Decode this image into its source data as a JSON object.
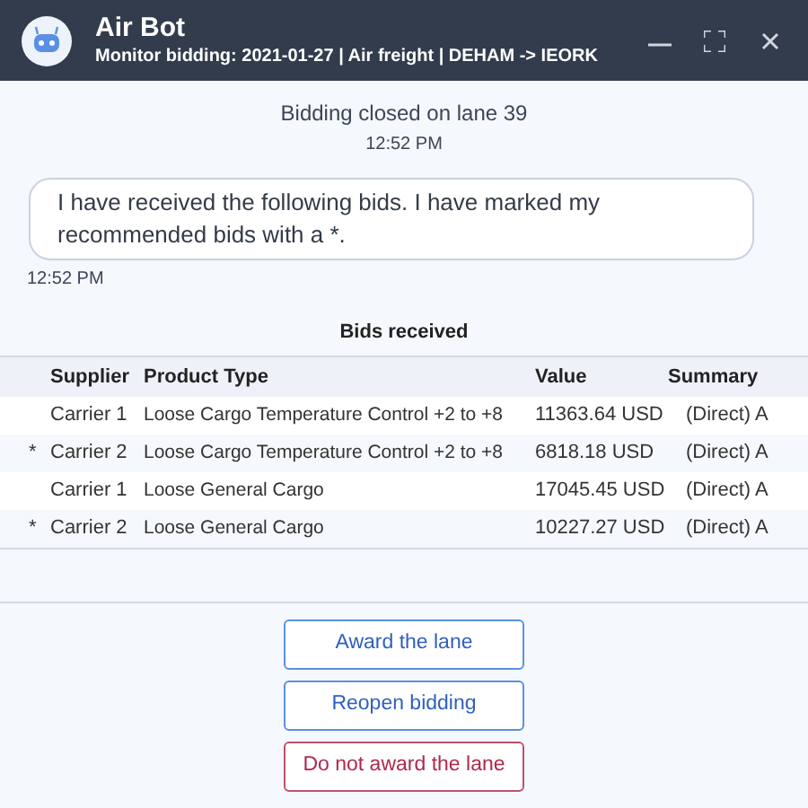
{
  "window": {
    "title": "Air Bot",
    "subtitle": "Monitor bidding: 2021-01-27 | Air freight | DEHAM -> IEORK"
  },
  "status": {
    "text": "Bidding closed on lane 39",
    "time": "12:52 PM"
  },
  "message": {
    "text": "I have received the following bids. I have marked my recommended bids with a *.",
    "time": "12:52 PM"
  },
  "table": {
    "title": "Bids received",
    "columns": [
      "Supplier",
      "Product Type",
      "Value",
      "Summary"
    ],
    "rows": [
      {
        "mark": "",
        "supplier": "Carrier 1",
        "product": "Loose Cargo Temperature Control +2 to +8",
        "value": "11363.64 USD",
        "summary": "(Direct) A"
      },
      {
        "mark": "*",
        "supplier": "Carrier 2",
        "product": "Loose Cargo Temperature Control +2 to +8",
        "value": "6818.18 USD",
        "summary": "(Direct) A"
      },
      {
        "mark": "",
        "supplier": "Carrier 1",
        "product": "Loose General Cargo",
        "value": "17045.45 USD",
        "summary": "(Direct) A"
      },
      {
        "mark": "*",
        "supplier": "Carrier 2",
        "product": "Loose General Cargo",
        "value": "10227.27 USD",
        "summary": "(Direct) A"
      }
    ]
  },
  "buttons": [
    {
      "label": "Award the lane",
      "kind": "primary"
    },
    {
      "label": "Reopen bidding",
      "kind": "primary"
    },
    {
      "label": "Do not award the lane",
      "kind": "danger"
    }
  ]
}
